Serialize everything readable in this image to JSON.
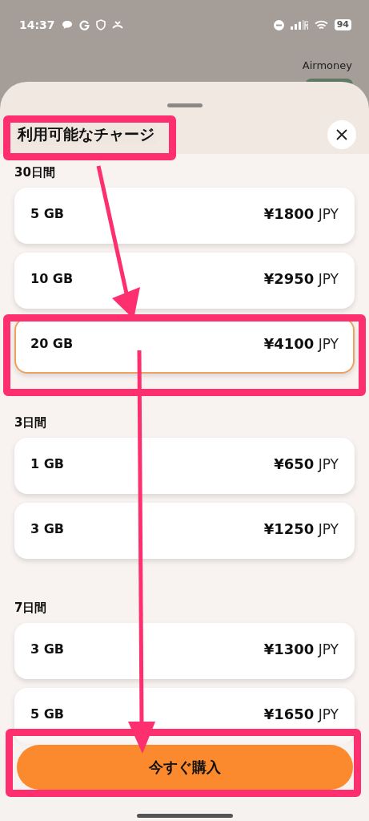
{
  "status_bar": {
    "time": "14:37",
    "battery": "94"
  },
  "background": {
    "label": "Airmoney"
  },
  "sheet": {
    "title": "利用可能なチャージ",
    "sections": [
      {
        "heading": "30日間",
        "plans": [
          {
            "data": "5 GB",
            "price": "¥1800",
            "currency": "JPY",
            "selected": false
          },
          {
            "data": "10 GB",
            "price": "¥2950",
            "currency": "JPY",
            "selected": false
          },
          {
            "data": "20 GB",
            "price": "¥4100",
            "currency": "JPY",
            "selected": true
          }
        ]
      },
      {
        "heading": "3日間",
        "plans": [
          {
            "data": "1 GB",
            "price": "¥650",
            "currency": "JPY",
            "selected": false
          },
          {
            "data": "3 GB",
            "price": "¥1250",
            "currency": "JPY",
            "selected": false
          }
        ]
      },
      {
        "heading": "7日間",
        "plans": [
          {
            "data": "3 GB",
            "price": "¥1300",
            "currency": "JPY",
            "selected": false
          },
          {
            "data": "5 GB",
            "price": "¥1650",
            "currency": "JPY",
            "selected": false
          }
        ]
      }
    ],
    "buy_button": "今すぐ購入"
  }
}
